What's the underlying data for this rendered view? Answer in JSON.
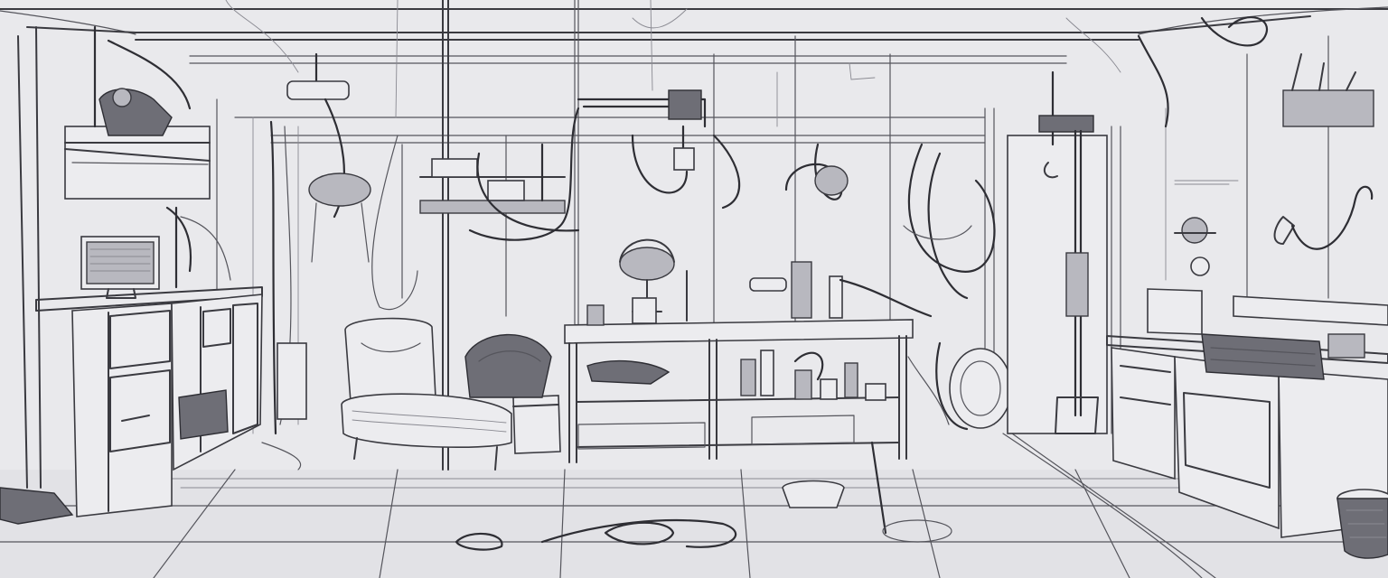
{
  "scene": {
    "style": "pencil line sketch",
    "palette": {
      "background": "#e6e6e9",
      "ink": "#3a3a40",
      "shade": "#b8b8bf"
    }
  }
}
